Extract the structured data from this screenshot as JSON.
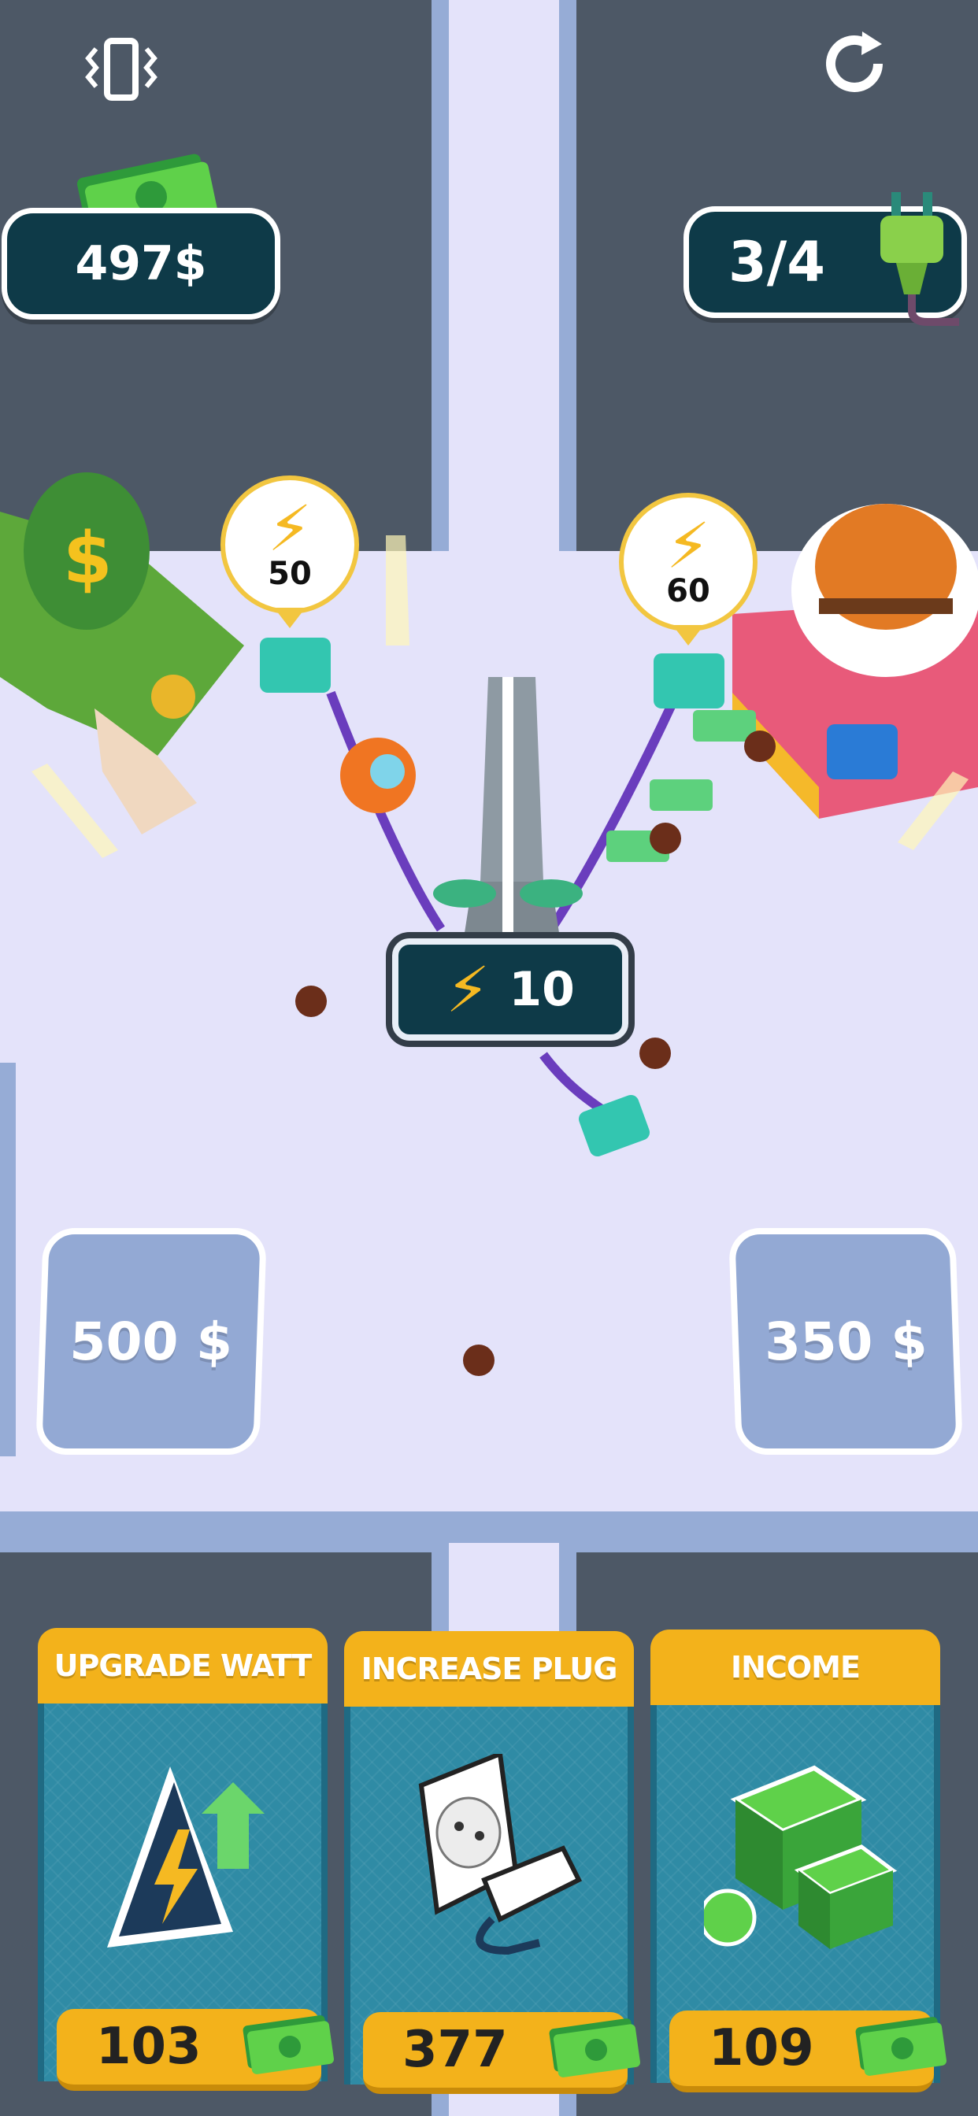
{
  "hud": {
    "money": "497$",
    "plugs": "3/4",
    "vibrate_icon": "vibrate-icon",
    "restart_icon": "restart-icon"
  },
  "map": {
    "bank_watt": "50",
    "burger_watt": "60",
    "tower_watt": "10",
    "slot_left_price": "500 $",
    "slot_right_price": "350 $"
  },
  "upgrades": [
    {
      "title": "UPGRADE WATT",
      "price": "103",
      "icon": "watt-upgrade-icon"
    },
    {
      "title": "INCREASE PLUG",
      "price": "377",
      "icon": "plug-socket-icon"
    },
    {
      "title": "INCOME",
      "price": "109",
      "icon": "money-stack-icon"
    }
  ],
  "colors": {
    "accent_yellow": "#f3b21b",
    "panel_teal": "#2f8ba5",
    "hud_dark": "#0e3a48",
    "ground": "#e4e3fa"
  }
}
